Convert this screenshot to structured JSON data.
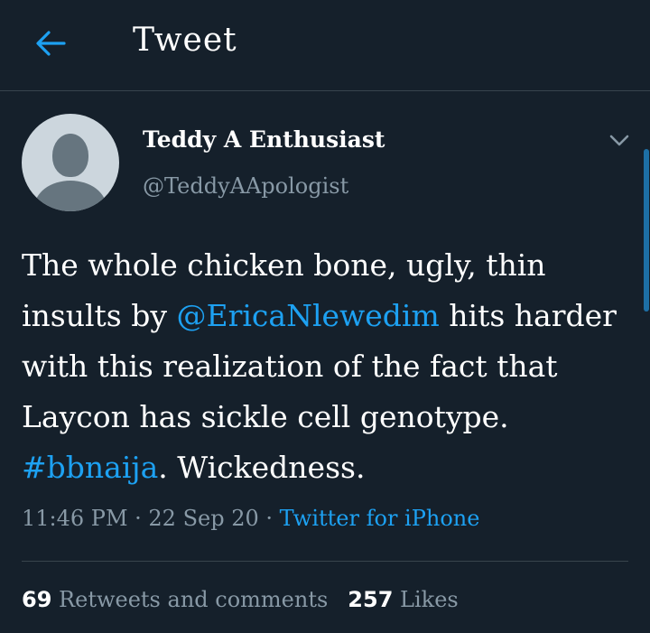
{
  "header": {
    "title": "Tweet",
    "back_icon": "arrow-left-icon"
  },
  "author": {
    "display_name": "Teddy A Enthusiast",
    "handle": "@TeddyAApologist",
    "avatar_icon": "default-avatar-icon"
  },
  "tweet": {
    "text_1": "The whole chicken bone, ugly, thin insults by ",
    "mention": "@EricaNlewedim",
    "text_2": " hits harder with this realization of the fact that Laycon has sickle cell genotype. ",
    "hashtag": "#bbnaija",
    "text_3": ". Wickedness."
  },
  "meta": {
    "time": "11:46 PM",
    "separator_1": " · ",
    "date": "22 Sep 20",
    "separator_2": " · ",
    "source": "Twitter for iPhone"
  },
  "stats": {
    "retweets_count": "69",
    "retweets_label": "Retweets and comments",
    "likes_count": "257",
    "likes_label": "Likes"
  },
  "colors": {
    "background": "#15202b",
    "accent": "#1da1f2",
    "secondary_text": "#8899a6",
    "divider": "#38444d"
  }
}
